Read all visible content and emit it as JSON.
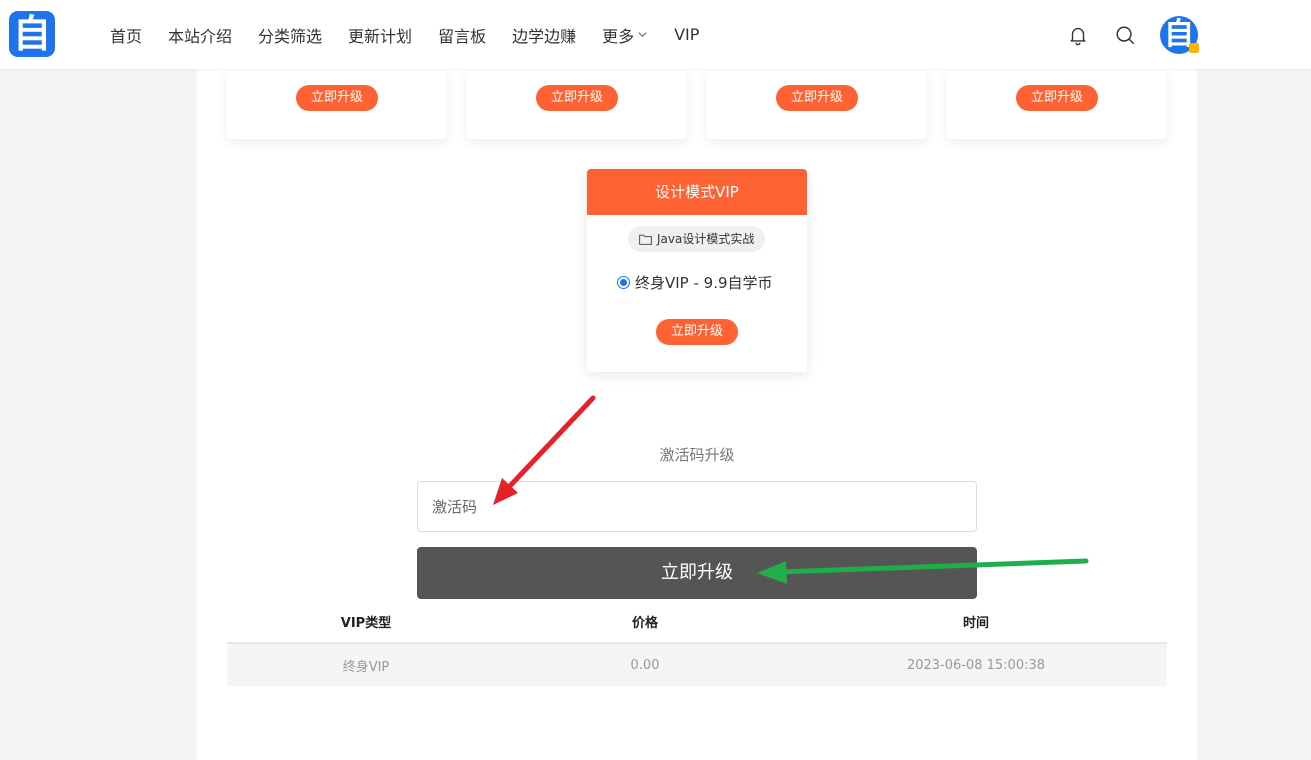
{
  "header": {
    "logo_text": "自",
    "nav": [
      {
        "label": "首页"
      },
      {
        "label": "本站介绍"
      },
      {
        "label": "分类筛选"
      },
      {
        "label": "更新计划"
      },
      {
        "label": "留言板"
      },
      {
        "label": "边学边赚"
      },
      {
        "label": "更多"
      },
      {
        "label": "VIP"
      }
    ],
    "avatar_text": "自"
  },
  "top_cards": [
    {
      "button_label": "立即升级"
    },
    {
      "button_label": "立即升级"
    },
    {
      "button_label": "立即升级"
    },
    {
      "button_label": "立即升级"
    }
  ],
  "vip_card": {
    "title": "设计模式VIP",
    "tag": "Java设计模式实战",
    "option_label": "终身VIP - 9.9自学币",
    "option_selected": true,
    "button_label": "立即升级"
  },
  "activation": {
    "title": "激活码升级",
    "placeholder": "激活码",
    "submit_label": "立即升级"
  },
  "history_table": {
    "columns": [
      "VIP类型",
      "价格",
      "时间"
    ],
    "rows": [
      [
        "终身VIP",
        "0.00",
        "2023-06-08 15:00:38"
      ]
    ]
  },
  "colors": {
    "accent": "#fe6232",
    "brand": "#1f73ec",
    "submit_button": "#555555",
    "red_arrow": "#e8202a",
    "green_arrow": "#1fae4a"
  }
}
